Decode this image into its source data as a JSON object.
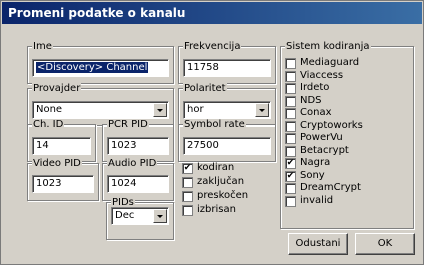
{
  "window": {
    "title": "Promeni podatke o kanalu"
  },
  "fields": {
    "ime": {
      "label": "Ime",
      "value": "<Discovery> Channel"
    },
    "frekvencija": {
      "label": "Frekvencija",
      "value": "11758"
    },
    "provajder": {
      "label": "Provajder",
      "value": "None"
    },
    "polaritet": {
      "label": "Polaritet",
      "value": "hor"
    },
    "ch_id": {
      "label": "Ch. ID",
      "value": "14"
    },
    "pcr_pid": {
      "label": "PCR PID",
      "value": "1023"
    },
    "symbol_rate": {
      "label": "Symbol rate",
      "value": "27500"
    },
    "video_pid": {
      "label": "Video PID",
      "value": "1023"
    },
    "audio_pid": {
      "label": "Audio PID",
      "value": "1024"
    },
    "pids": {
      "label": "PIDs",
      "value": "Dec"
    }
  },
  "flags": [
    {
      "label": "kodiran",
      "checked": true
    },
    {
      "label": "zaključan",
      "checked": false
    },
    {
      "label": "preskočen",
      "checked": false
    },
    {
      "label": "izbrisan",
      "checked": false
    }
  ],
  "encryption": {
    "label": "Sistem kodiranja",
    "systems": [
      {
        "label": "Mediaguard",
        "checked": false
      },
      {
        "label": "Viaccess",
        "checked": false
      },
      {
        "label": "Irdeto",
        "checked": false
      },
      {
        "label": "NDS",
        "checked": false
      },
      {
        "label": "Conax",
        "checked": false
      },
      {
        "label": "Cryptoworks",
        "checked": false
      },
      {
        "label": "PowerVu",
        "checked": false
      },
      {
        "label": "Betacrypt",
        "checked": false
      },
      {
        "label": "Nagra",
        "checked": true
      },
      {
        "label": "Sony",
        "checked": true
      },
      {
        "label": "DreamCrypt",
        "checked": false
      },
      {
        "label": "invalid",
        "checked": false
      }
    ]
  },
  "buttons": {
    "cancel": "Odustani",
    "ok": "OK"
  },
  "check_mark": "✔"
}
